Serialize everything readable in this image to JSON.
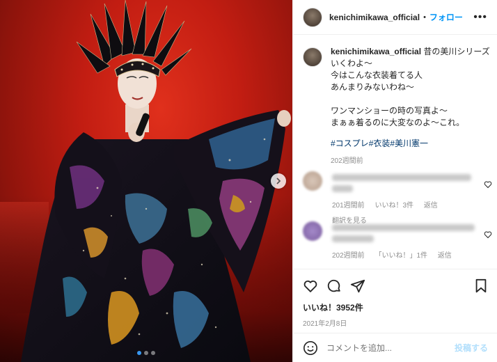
{
  "post": {
    "username": "kenichimikawa_official",
    "separator": "•",
    "follow_label": "フォロー",
    "more_label": "•••"
  },
  "caption": {
    "username": "kenichimikawa_official",
    "line1": "昔の美川シリーズいくわよ〜",
    "line2": "今はこんな衣装着てる人",
    "line3": "あんまりみないわね〜",
    "line4": "ワンマンショーの時の写真よ〜",
    "line5": "まぁぁ着るのに大変なのよ〜これ。",
    "hashtags": [
      "#コスプレ",
      "#衣装",
      "#美川憲一"
    ],
    "time": "202週間前"
  },
  "comments": [
    {
      "time": "201週間前",
      "likes": "いいね！3件",
      "reply": "返信",
      "translate": "翻訳を見る"
    },
    {
      "time": "202週間前",
      "likes": "「いいね！」1件",
      "reply": "返信"
    }
  ],
  "stats": {
    "likes": "いいね！3952件",
    "date": "2021年2月8日"
  },
  "comment_box": {
    "placeholder": "コメントを追加...",
    "post_label": "投稿する"
  },
  "icons": {
    "heart": "heart-icon",
    "comment": "comment-icon",
    "share": "share-icon",
    "bookmark": "bookmark-icon",
    "emoji": "emoji-icon",
    "arrow": "chevron-right-icon"
  },
  "carousel": {
    "total": 3,
    "active": 1
  },
  "colors": {
    "accent": "#0095f6",
    "link": "#00376b",
    "muted": "#8e8e8e"
  }
}
